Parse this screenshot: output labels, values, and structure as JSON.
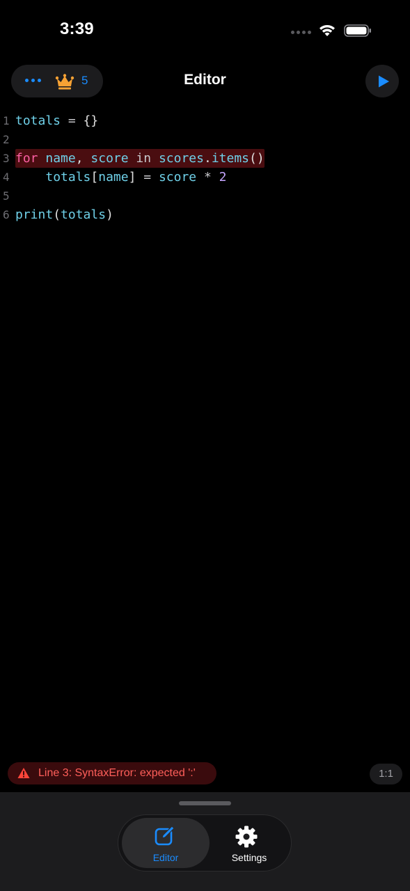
{
  "status_bar": {
    "time": "3:39"
  },
  "nav": {
    "title": "Editor",
    "crown_count": "5",
    "icons": {
      "more": "more-icon",
      "crown": "crown-icon",
      "run": "play-icon"
    },
    "accent_color": "#1a8cff",
    "crown_color": "#f7a234"
  },
  "editor": {
    "lines": [
      {
        "number": "1",
        "tokens": [
          {
            "t": "totals",
            "c": "id"
          },
          {
            "t": " = ",
            "c": "op"
          },
          {
            "t": "{}",
            "c": "plain"
          }
        ]
      },
      {
        "number": "2",
        "tokens": []
      },
      {
        "number": "3",
        "error": true,
        "tokens": [
          {
            "t": "for",
            "c": "kw"
          },
          {
            "t": " ",
            "c": "plain"
          },
          {
            "t": "name",
            "c": "id"
          },
          {
            "t": ", ",
            "c": "plain"
          },
          {
            "t": "score",
            "c": "id"
          },
          {
            "t": " in ",
            "c": "op"
          },
          {
            "t": "scores",
            "c": "id"
          },
          {
            "t": ".",
            "c": "plain"
          },
          {
            "t": "items",
            "c": "fn"
          },
          {
            "t": "()",
            "c": "plain"
          }
        ]
      },
      {
        "number": "4",
        "tokens": [
          {
            "t": "    ",
            "c": "plain"
          },
          {
            "t": "totals",
            "c": "id"
          },
          {
            "t": "[",
            "c": "plain"
          },
          {
            "t": "name",
            "c": "id"
          },
          {
            "t": "]",
            "c": "plain"
          },
          {
            "t": " = ",
            "c": "op"
          },
          {
            "t": "score",
            "c": "id"
          },
          {
            "t": " * ",
            "c": "op"
          },
          {
            "t": "2",
            "c": "num"
          }
        ]
      },
      {
        "number": "5",
        "tokens": []
      },
      {
        "number": "6",
        "tokens": [
          {
            "t": "print",
            "c": "fn"
          },
          {
            "t": "(",
            "c": "plain"
          },
          {
            "t": "totals",
            "c": "id"
          },
          {
            "t": ")",
            "c": "plain"
          }
        ]
      }
    ],
    "error_highlight_color": "#4a0d10"
  },
  "error": {
    "message": "Line 3: SyntaxError: expected ':'",
    "icon": "warning-icon",
    "color": "#ff5f5a"
  },
  "cursor_position": "1:1",
  "tab_bar": {
    "tabs": [
      {
        "label": "Editor",
        "icon": "compose-icon",
        "selected": true
      },
      {
        "label": "Settings",
        "icon": "gear-icon",
        "selected": false
      }
    ]
  }
}
